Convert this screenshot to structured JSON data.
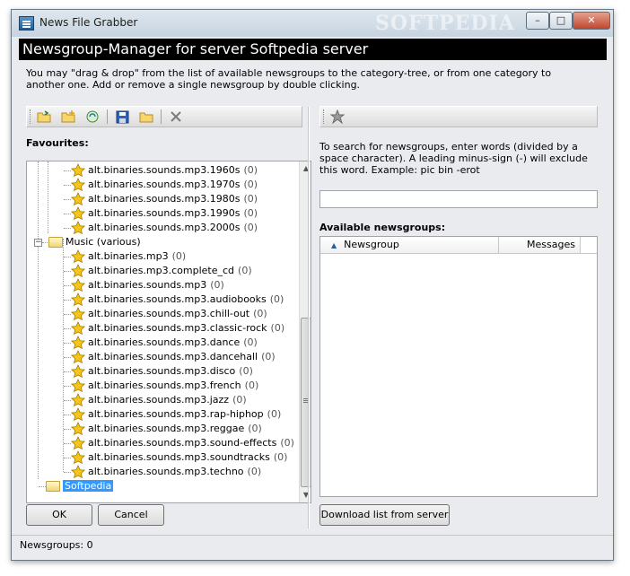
{
  "window": {
    "title": "News File Grabber",
    "watermark": "SOFTPEDIA",
    "controls": {
      "minimize": "–",
      "maximize": "□",
      "close": "✕"
    }
  },
  "header": {
    "title": "Newsgroup-Manager for server Softpedia server",
    "description": "You may \"drag & drop\" from the list of available newsgroups to the category-tree, or from one category to another one. Add or remove a single newsgroup by double clicking."
  },
  "left_panel": {
    "toolbar_icons": [
      "open-folder-icon",
      "new-folder-icon",
      "refresh-icon",
      "save-icon",
      "folder-icon",
      "delete-icon"
    ],
    "favourites_label": "Favourites:",
    "tree": {
      "top_items": [
        {
          "name": "alt.binaries.sounds.mp3.1960s",
          "count": "(0)"
        },
        {
          "name": "alt.binaries.sounds.mp3.1970s",
          "count": "(0)"
        },
        {
          "name": "alt.binaries.sounds.mp3.1980s",
          "count": "(0)"
        },
        {
          "name": "alt.binaries.sounds.mp3.1990s",
          "count": "(0)"
        },
        {
          "name": "alt.binaries.sounds.mp3.2000s",
          "count": "(0)"
        }
      ],
      "music_folder": {
        "label": "Music (various)",
        "expander": "−"
      },
      "music_items": [
        {
          "name": "alt.binaries.mp3",
          "count": "(0)"
        },
        {
          "name": "alt.binaries.mp3.complete_cd",
          "count": "(0)"
        },
        {
          "name": "alt.binaries.sounds.mp3",
          "count": "(0)"
        },
        {
          "name": "alt.binaries.sounds.mp3.audiobooks",
          "count": "(0)"
        },
        {
          "name": "alt.binaries.sounds.mp3.chill-out",
          "count": "(0)"
        },
        {
          "name": "alt.binaries.sounds.mp3.classic-rock",
          "count": "(0)"
        },
        {
          "name": "alt.binaries.sounds.mp3.dance",
          "count": "(0)"
        },
        {
          "name": "alt.binaries.sounds.mp3.dancehall",
          "count": "(0)"
        },
        {
          "name": "alt.binaries.sounds.mp3.disco",
          "count": "(0)"
        },
        {
          "name": "alt.binaries.sounds.mp3.french",
          "count": "(0)"
        },
        {
          "name": "alt.binaries.sounds.mp3.jazz",
          "count": "(0)"
        },
        {
          "name": "alt.binaries.sounds.mp3.rap-hiphop",
          "count": "(0)"
        },
        {
          "name": "alt.binaries.sounds.mp3.reggae",
          "count": "(0)"
        },
        {
          "name": "alt.binaries.sounds.mp3.sound-effects",
          "count": "(0)"
        },
        {
          "name": "alt.binaries.sounds.mp3.soundtracks",
          "count": "(0)"
        },
        {
          "name": "alt.binaries.sounds.mp3.techno",
          "count": "(0)"
        }
      ],
      "selected_folder": {
        "label": "Softpedia"
      }
    },
    "ok_button": "OK",
    "cancel_button": "Cancel"
  },
  "right_panel": {
    "toolbar_icons": [
      "star-icon"
    ],
    "search_help": "To search for newsgroups, enter words (divided by a space character). A leading minus-sign (-) will exclude this word. Example: pic bin -erot",
    "search_value": "",
    "available_label": "Available newsgroups:",
    "columns": {
      "newsgroup": "Newsgroup",
      "messages": "Messages",
      "sort_indicator": "▲"
    },
    "download_button": "Download list from server"
  },
  "status_bar": {
    "text": "Newsgroups: 0"
  },
  "colors": {
    "header_bg": "#000000",
    "window_bg": "#e9ebef",
    "selection": "#3399ff",
    "star": "#f5c518"
  }
}
